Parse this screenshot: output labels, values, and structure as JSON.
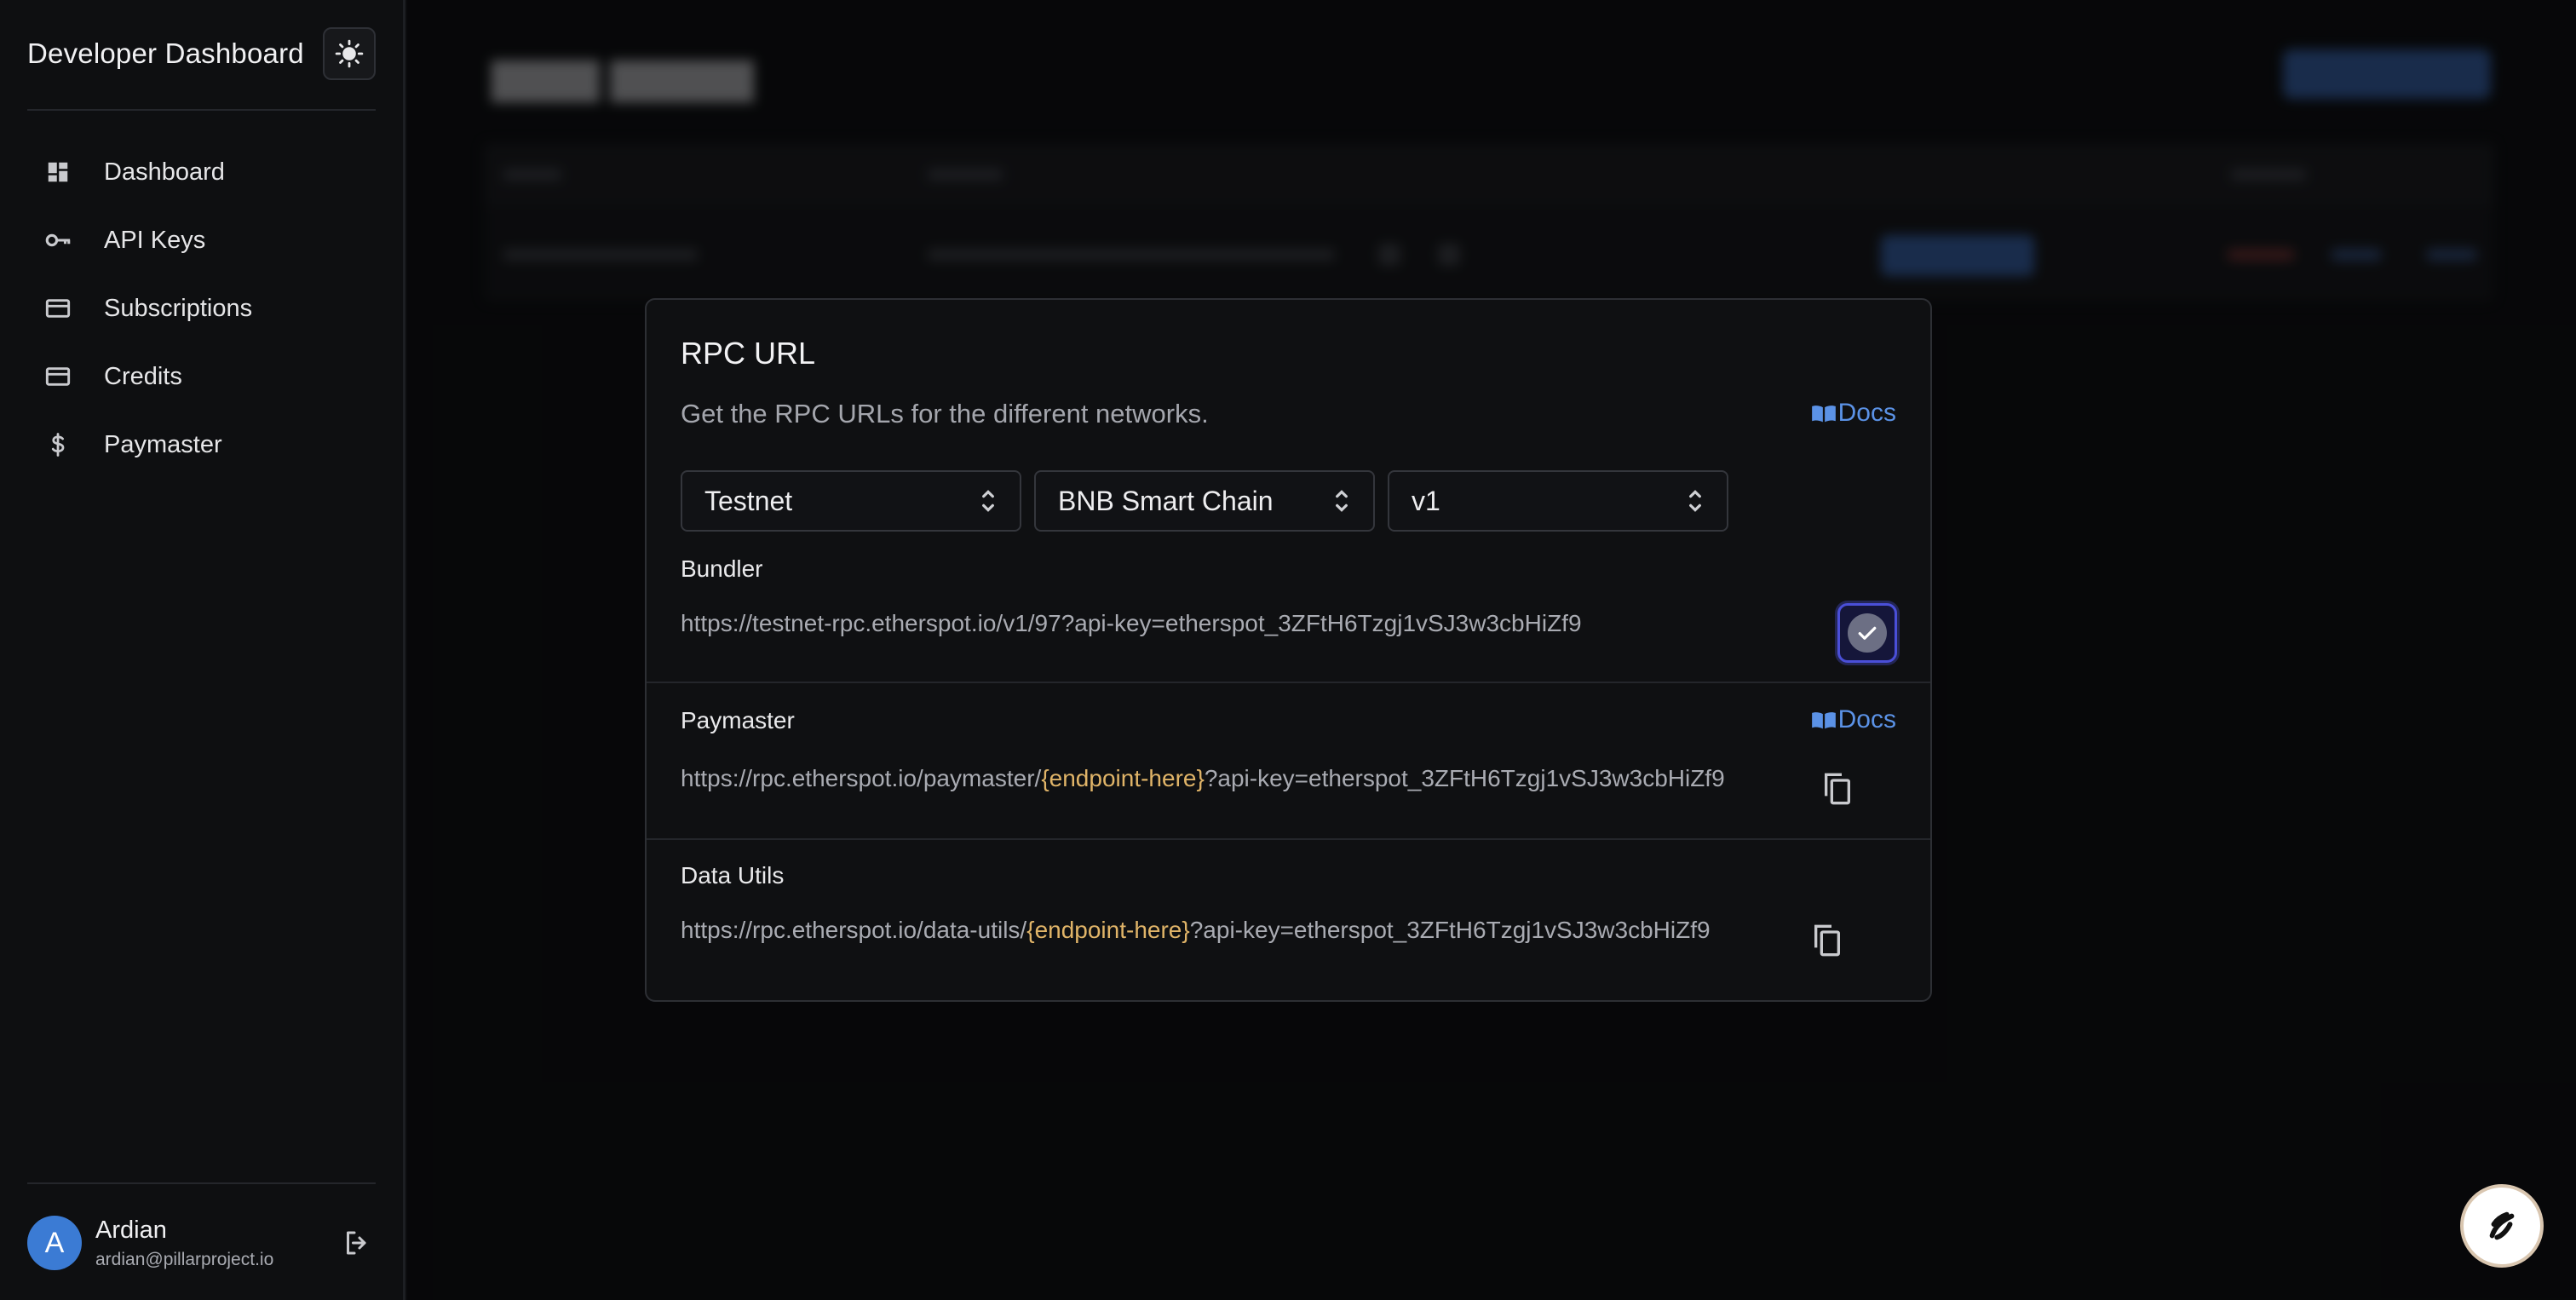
{
  "sidebar": {
    "title": "Developer Dashboard",
    "theme_icon": "sun-icon",
    "items": [
      {
        "label": "Dashboard",
        "icon": "dashboard-grid-icon"
      },
      {
        "label": "API Keys",
        "icon": "key-icon"
      },
      {
        "label": "Subscriptions",
        "icon": "credit-card-icon"
      },
      {
        "label": "Credits",
        "icon": "credit-card-icon"
      },
      {
        "label": "Paymaster",
        "icon": "dollar-icon"
      }
    ],
    "user": {
      "initial": "A",
      "name": "Ardian",
      "email": "ardian@pillarproject.io"
    }
  },
  "modal": {
    "title": "RPC URL",
    "subtitle": "Get the RPC URLs for the different networks.",
    "docs_label": "Docs",
    "selects": {
      "network": "Testnet",
      "chain": "BNB Smart Chain",
      "version": "v1"
    },
    "bundler": {
      "label": "Bundler",
      "url": "https://testnet-rpc.etherspot.io/v1/97?api-key=etherspot_3ZFtH6Tzgj1vSJ3w3cbHiZf9"
    },
    "paymaster": {
      "label": "Paymaster",
      "url_prefix": "https://rpc.etherspot.io/paymaster/",
      "url_endpoint": "{endpoint-here}",
      "url_suffix": "?api-key=etherspot_3ZFtH6Tzgj1vSJ3w3cbHiZf9"
    },
    "data_utils": {
      "label": "Data Utils",
      "url_prefix": "https://rpc.etherspot.io/data-utils/",
      "url_endpoint": "{endpoint-here}",
      "url_suffix": "?api-key=etherspot_3ZFtH6Tzgj1vSJ3w3cbHiZf9"
    }
  },
  "colors": {
    "accent": "#5b92e6",
    "highlight": "#e0b468",
    "background": "#0b0c0e"
  }
}
